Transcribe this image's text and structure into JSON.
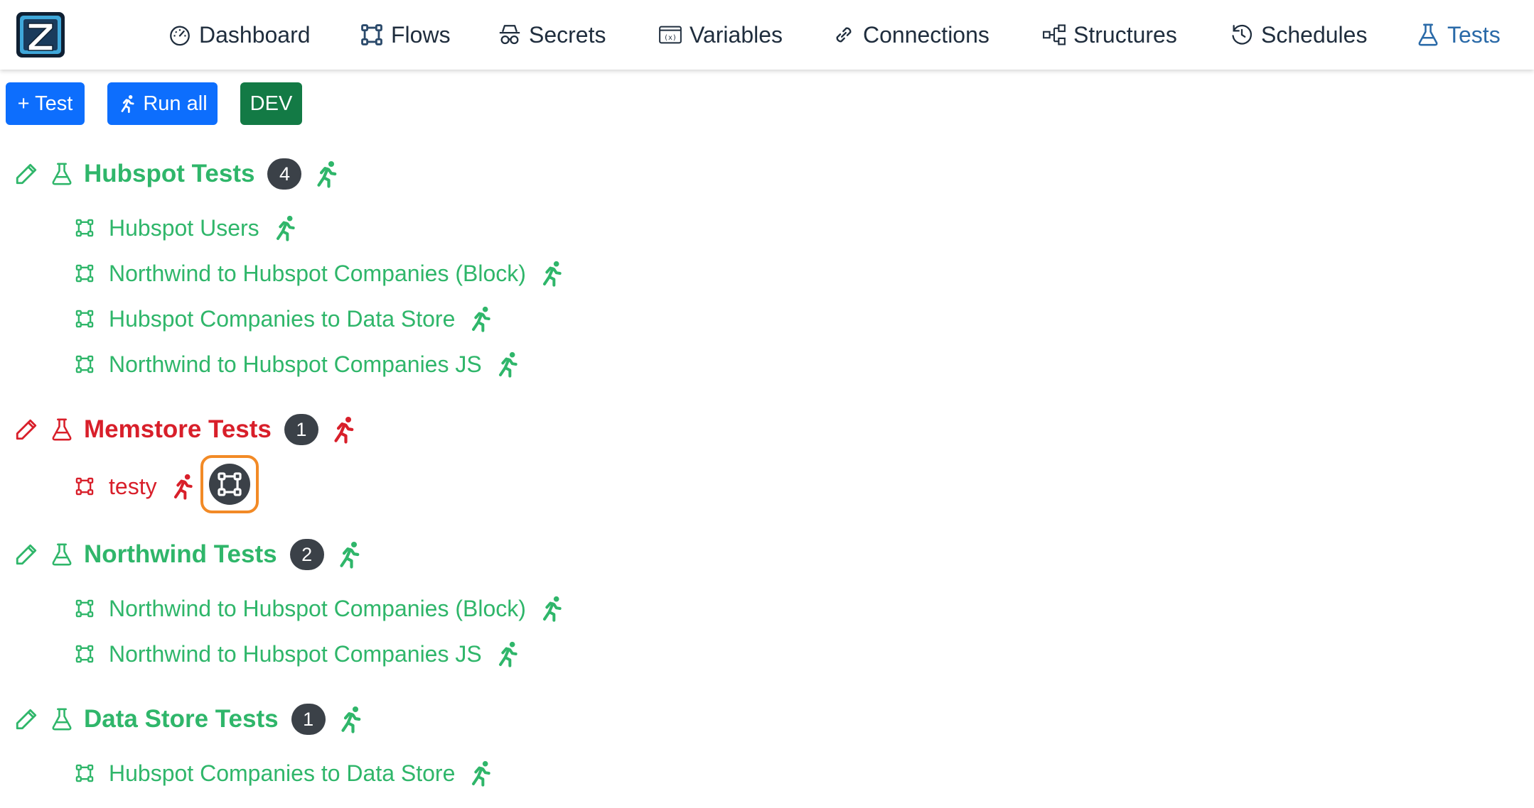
{
  "nav": {
    "dashboard": "Dashboard",
    "flows": "Flows",
    "secrets": "Secrets",
    "variables": "Variables",
    "connections": "Connections",
    "structures": "Structures",
    "schedules": "Schedules",
    "tests": "Tests",
    "active": "Tests"
  },
  "toolbar": {
    "add_test": "+ Test",
    "run_all": "Run all",
    "env": "DEV"
  },
  "groups": [
    {
      "title": "Hubspot Tests",
      "count": "4",
      "status": "pass",
      "items": [
        "Hubspot Users",
        "Northwind to Hubspot Companies (Block)",
        "Hubspot Companies to Data Store",
        "Northwind to Hubspot Companies JS"
      ]
    },
    {
      "title": "Memstore Tests",
      "count": "1",
      "status": "fail",
      "items": [
        "testy"
      ]
    },
    {
      "title": "Northwind Tests",
      "count": "2",
      "status": "pass",
      "items": [
        "Northwind to Hubspot Companies (Block)",
        "Northwind to Hubspot Companies JS"
      ]
    },
    {
      "title": "Data Store Tests",
      "count": "1",
      "status": "pass",
      "items": [
        "Hubspot Companies to Data Store"
      ]
    }
  ],
  "colors": {
    "pass": "#2fb66a",
    "fail": "#d81f2a",
    "primary": "#0d6efd",
    "env_badge": "#137a45",
    "highlight": "#f28a26"
  }
}
